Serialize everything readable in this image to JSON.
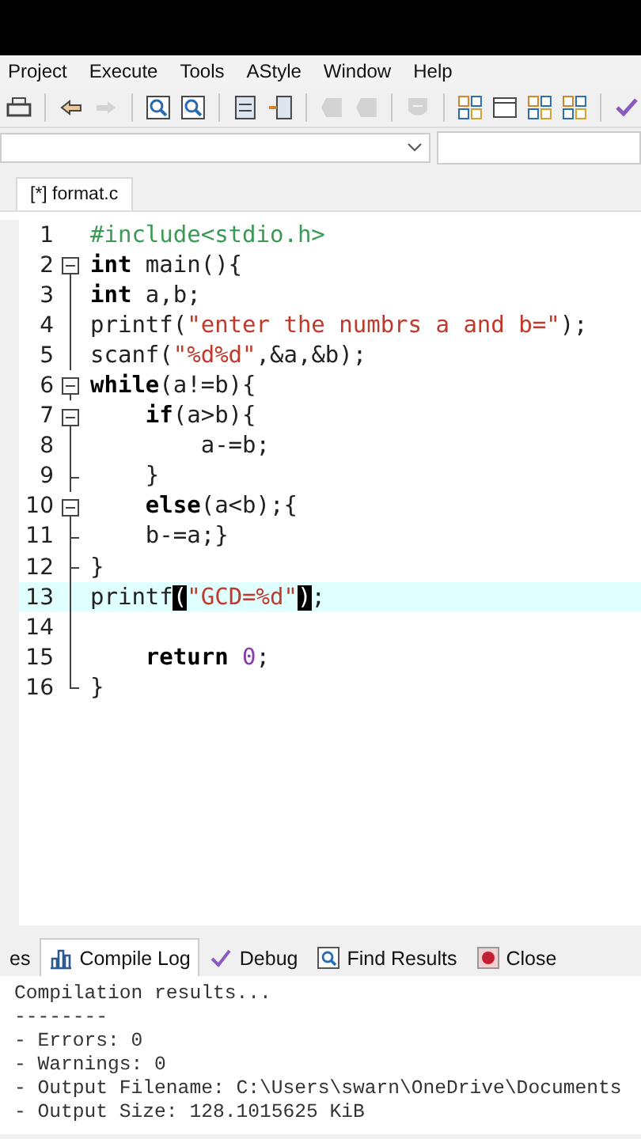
{
  "menu": [
    "Project",
    "Execute",
    "Tools",
    "AStyle",
    "Window",
    "Help"
  ],
  "toolbar": [
    {
      "kind": "print",
      "disabled": false
    },
    {
      "kind": "sep"
    },
    {
      "kind": "undo",
      "disabled": false
    },
    {
      "kind": "redo",
      "disabled": true
    },
    {
      "kind": "sep"
    },
    {
      "kind": "find",
      "disabled": false
    },
    {
      "kind": "find",
      "disabled": false
    },
    {
      "kind": "sep"
    },
    {
      "kind": "panel",
      "disabled": false
    },
    {
      "kind": "insert",
      "disabled": false
    },
    {
      "kind": "sep"
    },
    {
      "kind": "bookmark",
      "disabled": true
    },
    {
      "kind": "bookmark",
      "disabled": true
    },
    {
      "kind": "sep"
    },
    {
      "kind": "shield",
      "disabled": true
    },
    {
      "kind": "sep"
    },
    {
      "kind": "grid",
      "disabled": false
    },
    {
      "kind": "window",
      "disabled": false
    },
    {
      "kind": "grid",
      "disabled": false
    },
    {
      "kind": "grid",
      "disabled": false
    },
    {
      "kind": "sep"
    },
    {
      "kind": "check",
      "disabled": false
    }
  ],
  "editor_tab": {
    "label": "[*] format.c",
    "selected": true
  },
  "lines": [
    {
      "number": "1",
      "kind": "none",
      "selected": false,
      "tokens": [
        {
          "text": "#include<stdio.h>",
          "kind": "preproc"
        }
      ]
    },
    {
      "number": "2",
      "kind": "start",
      "selected": false,
      "tokens": [
        {
          "text": "int",
          "kind": "keyword"
        },
        {
          "text": " main(){",
          "kind": "plain"
        }
      ]
    },
    {
      "number": "3",
      "kind": "line",
      "selected": false,
      "tokens": [
        {
          "text": "int",
          "kind": "keyword"
        },
        {
          "text": " a,b;",
          "kind": "plain"
        }
      ]
    },
    {
      "number": "4",
      "kind": "line",
      "selected": false,
      "tokens": [
        {
          "text": "printf(",
          "kind": "plain"
        },
        {
          "text": "\"enter the numbrs a and b=\"",
          "kind": "string"
        },
        {
          "text": ");",
          "kind": "plain"
        }
      ]
    },
    {
      "number": "5",
      "kind": "line",
      "selected": false,
      "tokens": [
        {
          "text": "scanf(",
          "kind": "plain"
        },
        {
          "text": "\"%d%d\"",
          "kind": "string"
        },
        {
          "text": ",&a,&b);",
          "kind": "plain"
        }
      ]
    },
    {
      "number": "6",
      "kind": "start",
      "selected": false,
      "tokens": [
        {
          "text": "while",
          "kind": "keyword"
        },
        {
          "text": "(a!=b){",
          "kind": "plain"
        }
      ]
    },
    {
      "number": "7",
      "kind": "start",
      "selected": false,
      "tokens": [
        {
          "text": "    if",
          "kind": "keyword"
        },
        {
          "text": "(a>b){",
          "kind": "plain"
        }
      ]
    },
    {
      "number": "8",
      "kind": "line",
      "selected": false,
      "tokens": [
        {
          "text": "        a-=b;",
          "kind": "plain"
        }
      ]
    },
    {
      "number": "9",
      "kind": "branch",
      "selected": false,
      "tokens": [
        {
          "text": "    }",
          "kind": "plain"
        }
      ]
    },
    {
      "number": "10",
      "kind": "start",
      "selected": false,
      "tokens": [
        {
          "text": "    else",
          "kind": "keyword"
        },
        {
          "text": "(a<b);{",
          "kind": "plain"
        }
      ]
    },
    {
      "number": "11",
      "kind": "branch",
      "selected": false,
      "tokens": [
        {
          "text": "    b-=a;}",
          "kind": "plain"
        }
      ]
    },
    {
      "number": "12",
      "kind": "branch",
      "selected": false,
      "tokens": [
        {
          "text": "}",
          "kind": "plain"
        }
      ]
    },
    {
      "number": "13",
      "kind": "line",
      "selected": true,
      "tokens": [
        {
          "text": "printf",
          "kind": "plain"
        },
        {
          "text": "(",
          "kind": "match"
        },
        {
          "text": "\"GCD=%d\"",
          "kind": "string"
        },
        {
          "text": ")",
          "kind": "match"
        },
        {
          "text": ";",
          "kind": "plain"
        }
      ]
    },
    {
      "number": "14",
      "kind": "line",
      "selected": false
    },
    {
      "number": "15",
      "kind": "line",
      "selected": false,
      "tokens": [
        {
          "text": "    return ",
          "kind": "keyword"
        },
        {
          "text": "0",
          "kind": "number"
        },
        {
          "text": ";",
          "kind": "plain"
        }
      ]
    },
    {
      "number": "16",
      "kind": "end",
      "selected": false,
      "tokens": [
        {
          "text": "}",
          "kind": "plain"
        }
      ]
    }
  ],
  "bottom_tabs": [
    {
      "label": "es",
      "kind": "plain",
      "selected": false
    },
    {
      "label": "Compile Log",
      "kind": "log",
      "selected": true
    },
    {
      "label": "Debug",
      "kind": "debug",
      "selected": false
    },
    {
      "label": "Find Results",
      "kind": "find",
      "selected": false
    },
    {
      "label": "Close",
      "kind": "close",
      "selected": false
    }
  ],
  "log": [
    "Compilation results...",
    "--------",
    "- Errors: 0",
    "- Warnings: 0",
    "- Output Filename: C:\\Users\\swarn\\OneDrive\\Documents",
    "- Output Size: 128.1015625 KiB"
  ]
}
